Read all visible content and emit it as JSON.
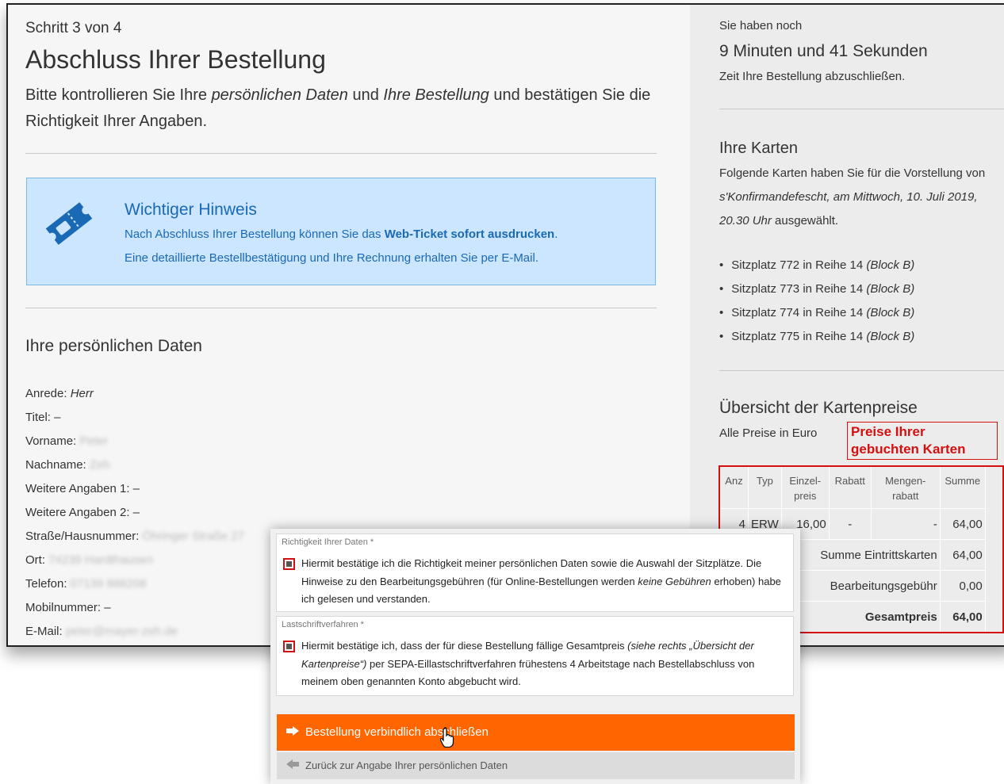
{
  "step": "Schritt 3 von 4",
  "title": "Abschluss Ihrer Bestellung",
  "intro": {
    "p1": "Bitte kontrollieren Sie Ihre ",
    "i1": "persönlichen Daten",
    "p2": " und ",
    "i2": "Ihre Bestellung",
    "p3": " und bestätigen Sie die Richtigkeit Ihrer Angaben."
  },
  "notice": {
    "icon": "ticket-icon",
    "title": "Wichtiger Hinweis",
    "line1_a": "Nach Abschluss Ihrer Bestellung können Sie das ",
    "line1_b": "Web-Ticket sofort ausdrucken",
    "line1_c": ".",
    "line2": "Eine detaillierte Bestellbestätigung und Ihre Rechnung erhalten Sie per E-Mail."
  },
  "personal": {
    "title": "Ihre persönlichen Daten",
    "fields": [
      {
        "label": "Anrede: ",
        "value": "Herr",
        "blurred": false,
        "italic": true
      },
      {
        "label": "Titel: ",
        "value": "–",
        "blurred": false
      },
      {
        "label": "Vorname: ",
        "value": "Peter",
        "blurred": true
      },
      {
        "label": "Nachname: ",
        "value": "Zeh",
        "blurred": true
      },
      {
        "label": "Weitere Angaben 1: ",
        "value": "–",
        "blurred": false
      },
      {
        "label": "Weitere Angaben 2: ",
        "value": "–",
        "blurred": false
      },
      {
        "label": "Straße/Hausnummer: ",
        "value": "Öhringer Straße 27",
        "blurred": true
      },
      {
        "label": "Ort: ",
        "value": "74239 Hardthausen",
        "blurred": true
      },
      {
        "label": "Telefon: ",
        "value": "07139 888208",
        "blurred": true
      },
      {
        "label": "Mobilnummer: ",
        "value": "–",
        "blurred": false
      },
      {
        "label": "E-Mail: ",
        "value": "peter@mayer-zeh.de",
        "blurred": true
      }
    ]
  },
  "timer": {
    "line1": "Sie haben noch",
    "line2": "9 Minuten und 41 Sekunden",
    "line3": "Zeit Ihre Bestellung abzuschließen."
  },
  "cards": {
    "title": "Ihre Karten",
    "text_a": "Folgende Karten haben Sie für die Vorstellung von ",
    "text_b": "s'Konfirmandefescht, am Mittwoch, 10. Juli 2019, 20.30 Uhr",
    "text_c": " ausgewählt.",
    "seats": [
      {
        "text": "Sitzplatz 772 in Reihe 14 ",
        "block": "(Block B)"
      },
      {
        "text": "Sitzplatz 773 in Reihe 14 ",
        "block": "(Block B)"
      },
      {
        "text": "Sitzplatz 774 in Reihe 14 ",
        "block": "(Block B)"
      },
      {
        "text": "Sitzplatz 775 in Reihe 14 ",
        "block": "(Block B)"
      }
    ]
  },
  "prices": {
    "title": "Übersicht der Kartenpreise",
    "note": "Alle Preise in Euro",
    "annotation": "Preise Ihrer gebuchten Karten",
    "headers": [
      "Anz",
      "Typ",
      "Einzel-preis",
      "Rabatt",
      "Mengen-rabatt",
      "Summe"
    ],
    "row": {
      "anz": "4",
      "typ": "ERW",
      "einzel": "16,00",
      "rabatt": "-",
      "mengen": "-",
      "summe": "64,00"
    },
    "summe_label": "Summe Eintrittskarten",
    "summe_value": "64,00",
    "gebuehr_label": "Bearbeitungsgebühr",
    "gebuehr_value": "0,00",
    "gesamt_label": "Gesamtpreis",
    "gesamt_value": "64,00"
  },
  "confirm": {
    "box1_head": "Richtigkeit Ihrer Daten *",
    "box1_a": "Hiermit bestätige ich die Richtigkeit meiner persönlichen Daten sowie die Auswahl der Sitzplätze. Die Hinweise zu den Bearbeitungsgebühren (für Online-Bestellungen werden ",
    "box1_b": "keine Gebühren",
    "box1_c": " erhoben) habe ich gelesen und verstanden.",
    "box2_head": "Lastschriftverfahren *",
    "box2_a": "Hiermit bestätige ich, dass der für diese Bestellung fällige Gesamtpreis ",
    "box2_b": "(siehe rechts „Übersicht der Kartenpreise“)",
    "box2_c": " per SEPA-Eillastschriftverfahren frühestens 4 Arbeitstage nach Bestellabschluss von meinem oben genannten Konto abgebucht wird.",
    "submit": "Bestellung verbindlich abschließen",
    "back": "Zurück zur Angabe Ihrer persönlichen Daten"
  },
  "colors": {
    "accent": "#ff6600",
    "notice_bg": "#cce6ff",
    "notice_text": "#1a69b5",
    "highlight": "#d31010"
  }
}
